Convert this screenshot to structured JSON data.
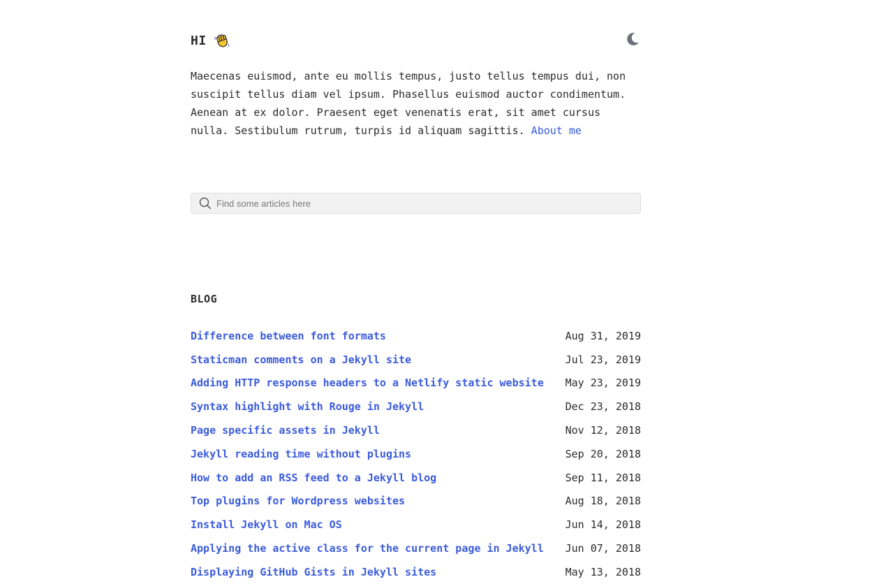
{
  "header": {
    "greeting": "HI",
    "greeting_icon": "waving-hand-icon",
    "theme_toggle_icon": "moon-icon"
  },
  "intro": {
    "text": "Maecenas euismod, ante eu mollis tempus, justo tellus tempus dui, non suscipit tellus diam vel ipsum. Phasellus euismod auctor condimentum. Aenean at ex dolor. Praesent eget venenatis erat, sit amet cursus nulla. Sestibulum rutrum, turpis id aliquam sagittis.",
    "about_link": "About me"
  },
  "search": {
    "placeholder": "Find some articles here",
    "value": "",
    "icon": "search-icon"
  },
  "blog": {
    "heading": "BLOG",
    "posts": [
      {
        "title": "Difference between font formats",
        "date": "Aug 31, 2019"
      },
      {
        "title": "Staticman comments on a Jekyll site",
        "date": "Jul 23, 2019"
      },
      {
        "title": "Adding HTTP response headers to a Netlify static website",
        "date": "May 23, 2019"
      },
      {
        "title": "Syntax highlight with Rouge in Jekyll",
        "date": "Dec 23, 2018"
      },
      {
        "title": "Page specific assets in Jekyll",
        "date": "Nov 12, 2018"
      },
      {
        "title": "Jekyll reading time without plugins",
        "date": "Sep 20, 2018"
      },
      {
        "title": "How to add an RSS feed to a Jekyll blog",
        "date": "Sep 11, 2018"
      },
      {
        "title": "Top plugins for Wordpress websites",
        "date": "Aug 18, 2018"
      },
      {
        "title": "Install Jekyll on Mac OS",
        "date": "Jun 14, 2018"
      },
      {
        "title": "Applying the active class for the current page in Jekyll",
        "date": "Jun 07, 2018"
      },
      {
        "title": "Displaying GitHub Gists in Jekyll sites",
        "date": "May 13, 2018"
      }
    ]
  },
  "colors": {
    "link": "#3b5bdb",
    "text": "#2b2b2b",
    "search_background": "#f2f2f2"
  }
}
